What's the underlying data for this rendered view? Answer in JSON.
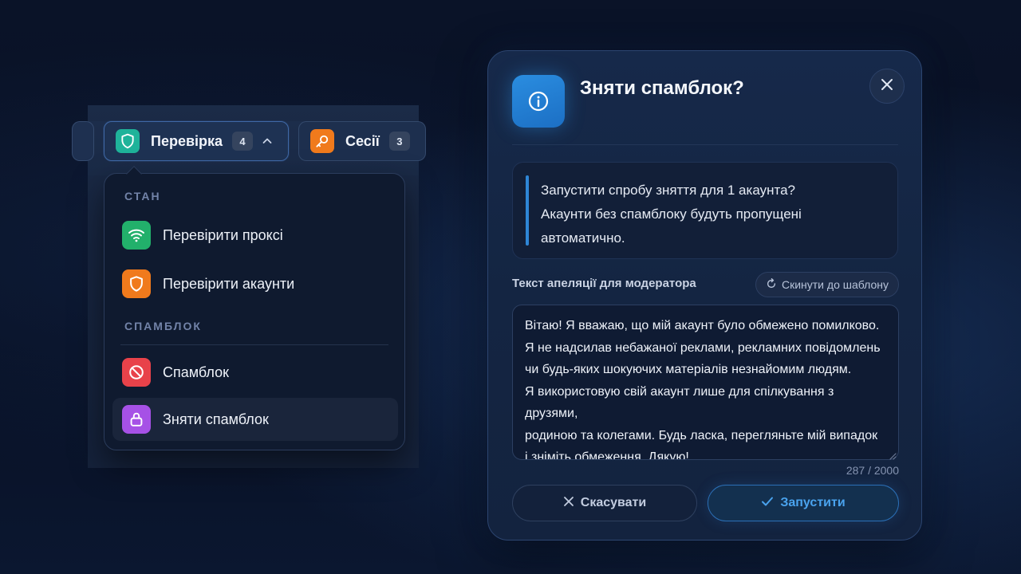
{
  "tabs": {
    "check": {
      "label": "Перевірка",
      "count": "4",
      "icon": "shield-icon",
      "color": "#1fb39a"
    },
    "sessions": {
      "label": "Сесії",
      "count": "3",
      "icon": "key-icon",
      "color": "#f07a1c"
    }
  },
  "dropdown": {
    "section_state": "СТАН",
    "section_spamblock": "СПАМБЛОК",
    "items": [
      {
        "label": "Перевірити проксі",
        "icon": "wifi-icon",
        "color": "#22b06b"
      },
      {
        "label": "Перевірити акаунти",
        "icon": "shield-icon",
        "color": "#f07a1c"
      },
      {
        "label": "Спамблок",
        "icon": "ban-icon",
        "color": "#e8424a"
      },
      {
        "label": "Зняти спамблок",
        "icon": "lock-icon",
        "color": "#a651e6"
      }
    ]
  },
  "modal": {
    "title": "Зняти спамблок?",
    "info_line1": "Запустити спробу зняття для 1 акаунта?",
    "info_line2": "Акаунти без спамблоку будуть пропущені",
    "info_line3": "автоматично.",
    "field_label": "Текст апеляції для модератора",
    "reset_label": "Скинути до шаблону",
    "appeal_text": "Вітаю! Я вважаю, що мій акаунт було обмежено помилково.\nЯ не надсилав небажаної реклами, рекламних повідомлень\nчи будь-яких шокуючих матеріалів незнайомим людям.\nЯ використовую свій акаунт лише для спілкування з друзями,\nродиною та колегами. Будь ласка, перегляньте мій випадок\nі зніміть обмеження. Дякую!",
    "counter": "287 / 2000",
    "cancel_label": "Скасувати",
    "run_label": "Запустити",
    "accent": "#2e86d6"
  }
}
